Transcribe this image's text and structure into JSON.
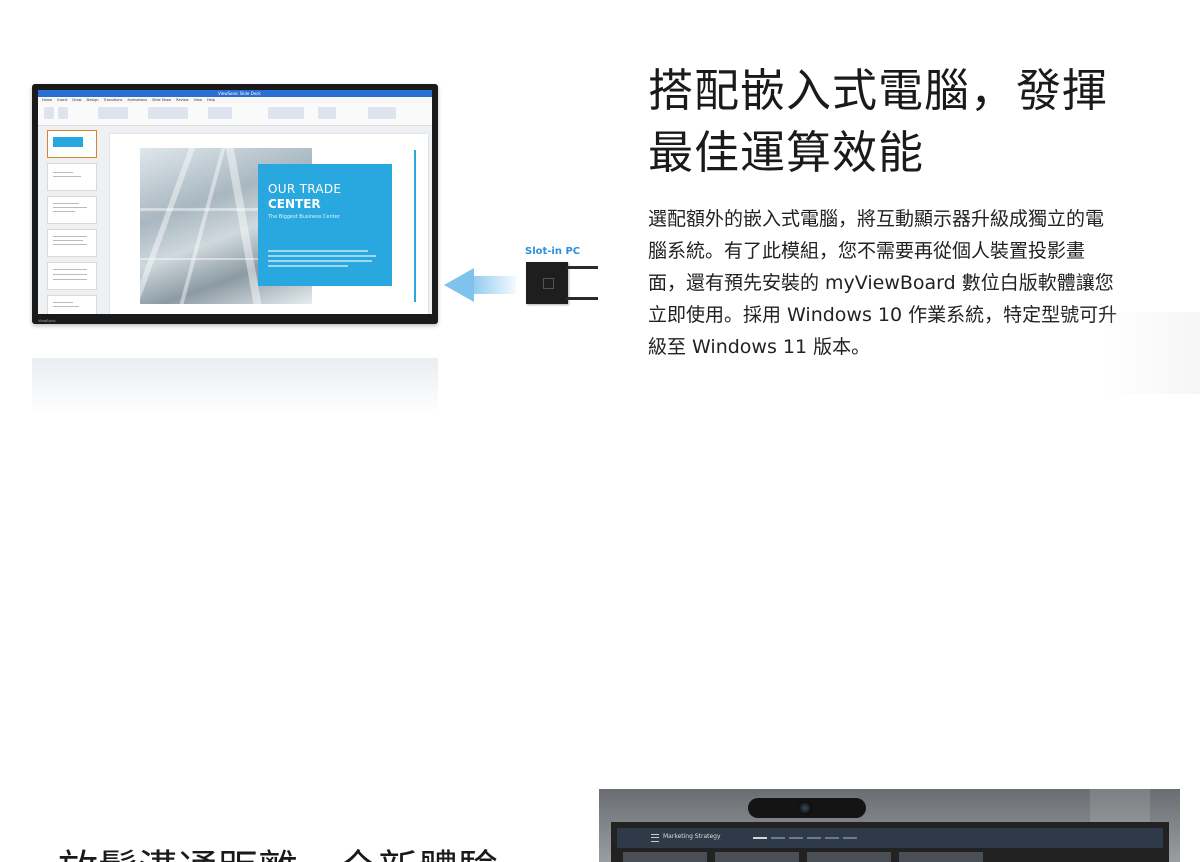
{
  "display": {
    "titlebar_text": "ViewSonic Slide Deck",
    "ribbon_tabs": [
      "Home",
      "Insert",
      "Draw",
      "Design",
      "Transitions",
      "Animations",
      "Slide Show",
      "Review",
      "View",
      "Help"
    ],
    "slide": {
      "line1": "OUR TRADE",
      "line2": "CENTER",
      "line3": "The Biggest Business Center"
    },
    "brand": "ViewSonic"
  },
  "slot_in_pc": {
    "label": "Slot-in PC"
  },
  "section": {
    "heading": "搭配嵌入式電腦，發揮最佳運算效能",
    "body": "選配額外的嵌入式電腦，將互動顯示器升級成獨立的電腦系統。有了此模組，您不需要再從個人裝置投影畫面，還有預先安裝的 myViewBoard 數位白版軟體讓您立即使用。採用 Windows 10 作業系統，特定型號可升級至 Windows 11 版本。"
  },
  "next_section": {
    "heading": "放鬆溝通距離，全新體驗",
    "meeting_title": "Marketing Strategy"
  },
  "colors": {
    "accent_blue": "#29a8e0",
    "label_blue": "#2f8fd8",
    "text_dark": "#1a1a1a"
  }
}
